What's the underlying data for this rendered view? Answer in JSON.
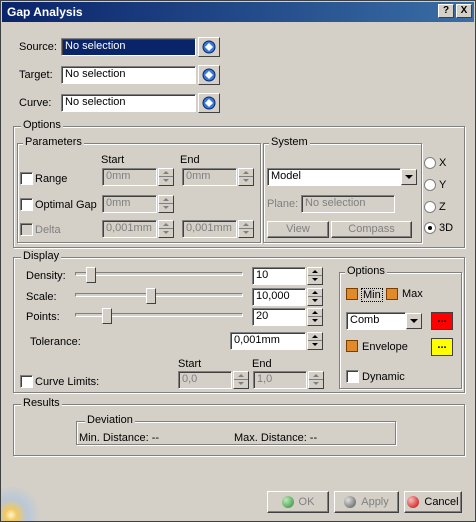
{
  "window": {
    "title": "Gap Analysis",
    "help_btn": "?",
    "close_btn": "X"
  },
  "selection": {
    "source_label": "Source:",
    "source_value": "No selection",
    "target_label": "Target:",
    "target_value": "No selection",
    "curve_label": "Curve:",
    "curve_value": "No selection"
  },
  "options_group": {
    "label": "Options"
  },
  "parameters": {
    "label": "Parameters",
    "start_header": "Start",
    "end_header": "End",
    "range_label": "Range",
    "range_start": "0mm",
    "range_end": "0mm",
    "optimal_gap_label": "Optimal Gap",
    "optimal_gap_value": "0mm",
    "delta_label": "Delta",
    "delta_start": "0,001mm",
    "delta_end": "0,001mm"
  },
  "system": {
    "label": "System",
    "type_value": "Model",
    "plane_label": "Plane:",
    "plane_value": "No selection",
    "view_button": "View",
    "compass_button": "Compass",
    "axes": [
      "X",
      "Y",
      "Z",
      "3D"
    ],
    "selected_axis": "3D"
  },
  "display": {
    "label": "Display",
    "density_label": "Density:",
    "density_value": "10",
    "density_level": 0.07,
    "scale_label": "Scale:",
    "scale_value": "10,000",
    "scale_level": 0.45,
    "points_label": "Points:",
    "points_value": "20",
    "points_level": 0.17,
    "tolerance_label": "Tolerance:",
    "tolerance_value": "0,001mm",
    "curve_limits_label": "Curve Limits:",
    "start_header": "Start",
    "end_header": "End",
    "curve_start_value": "0,0",
    "curve_end_value": "1,0"
  },
  "display_options": {
    "label": "Options",
    "min_label": "Min",
    "max_label": "Max",
    "comb_value": "Comb",
    "envelope_label": "Envelope",
    "dynamic_label": "Dynamic",
    "swatch_text": "...",
    "colors": {
      "comb": "#ff0000",
      "envelope": "#ffff00",
      "checked": "#e08a2a"
    }
  },
  "results": {
    "label": "Results",
    "deviation_label": "Deviation",
    "min_distance": "Min. Distance: --",
    "max_distance": "Max. Distance: --"
  },
  "footer": {
    "ok_label": "OK",
    "apply_label": "Apply",
    "cancel_label": "Cancel"
  },
  "icons": [
    "selection-picker-icon",
    "ok-icon",
    "apply-icon",
    "cancel-icon",
    "help-icon",
    "close-icon"
  ]
}
